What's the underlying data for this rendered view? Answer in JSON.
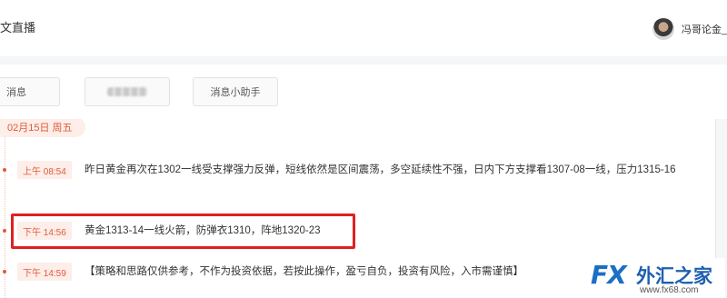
{
  "header": {
    "title": "文直播",
    "user_name": "冯哥论金_"
  },
  "tabs": [
    {
      "label": "消息"
    },
    {
      "label": ""
    },
    {
      "label": "消息小助手"
    }
  ],
  "feed": {
    "date": "02月15日 周五",
    "messages": [
      {
        "time": "上午 08:54",
        "text": "昨日黄金再次在1302一线受支撑强力反弹，短线依然是区间震荡，多空延续性不强，日内下方支撑看1307-08一线，压力1315-16"
      },
      {
        "time": "下午 14:56",
        "text": "黄金1313-14一线火箭，防弹衣1310，阵地1320-23"
      },
      {
        "time": "下午 14:59",
        "text": "【策略和思路仅供参考，不作为投资依据，若按此操作，盈亏自负，投资有风险，入市需谨慎】"
      }
    ]
  },
  "watermark": {
    "logo_text": "FX",
    "brand": "外汇之家",
    "url": "www.fx68.com"
  }
}
